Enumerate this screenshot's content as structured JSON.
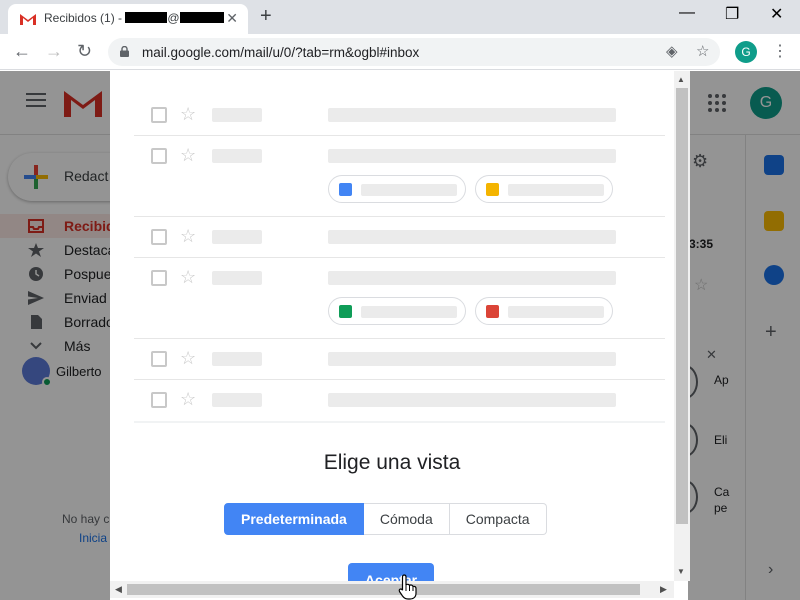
{
  "browser": {
    "tab_title_prefix": "Recibidos (1) - ",
    "tab_title_at": "@",
    "tab_close": "✕",
    "new_tab": "+",
    "minimize": "—",
    "maximize": "❐",
    "close": "✕",
    "back": "←",
    "forward": "→",
    "reload": "↻",
    "url": "mail.google.com/mail/u/0/?tab=rm&ogbl#inbox",
    "profile_initial": "G",
    "menu": "⋮"
  },
  "gmail": {
    "account_initial": "G",
    "compose_label": "Redact",
    "nav": [
      {
        "label": "Recibid",
        "active": true
      },
      {
        "label": "Destaca"
      },
      {
        "label": "Pospue"
      },
      {
        "label": "Enviad"
      },
      {
        "label": "Borrado"
      },
      {
        "label": "Más"
      }
    ],
    "hangouts_user": "Gilberto",
    "side_text": "No hay c",
    "side_link": "Inicia",
    "time": "3:35",
    "contact_snippets": [
      "Ap",
      "Eli",
      "Ca",
      "pe"
    ]
  },
  "modal": {
    "title": "Elige una vista",
    "options": [
      {
        "label": "Predeterminada",
        "selected": true
      },
      {
        "label": "Cómoda",
        "selected": false
      },
      {
        "label": "Compacta",
        "selected": false
      }
    ],
    "accept_label": "Aceptar"
  },
  "colors": {
    "accent": "#4285f4",
    "gmail_red": "#d93025",
    "docs": "#4285f4",
    "slides": "#f4b400",
    "sheets": "#0f9d58",
    "photos": "#db4437"
  }
}
